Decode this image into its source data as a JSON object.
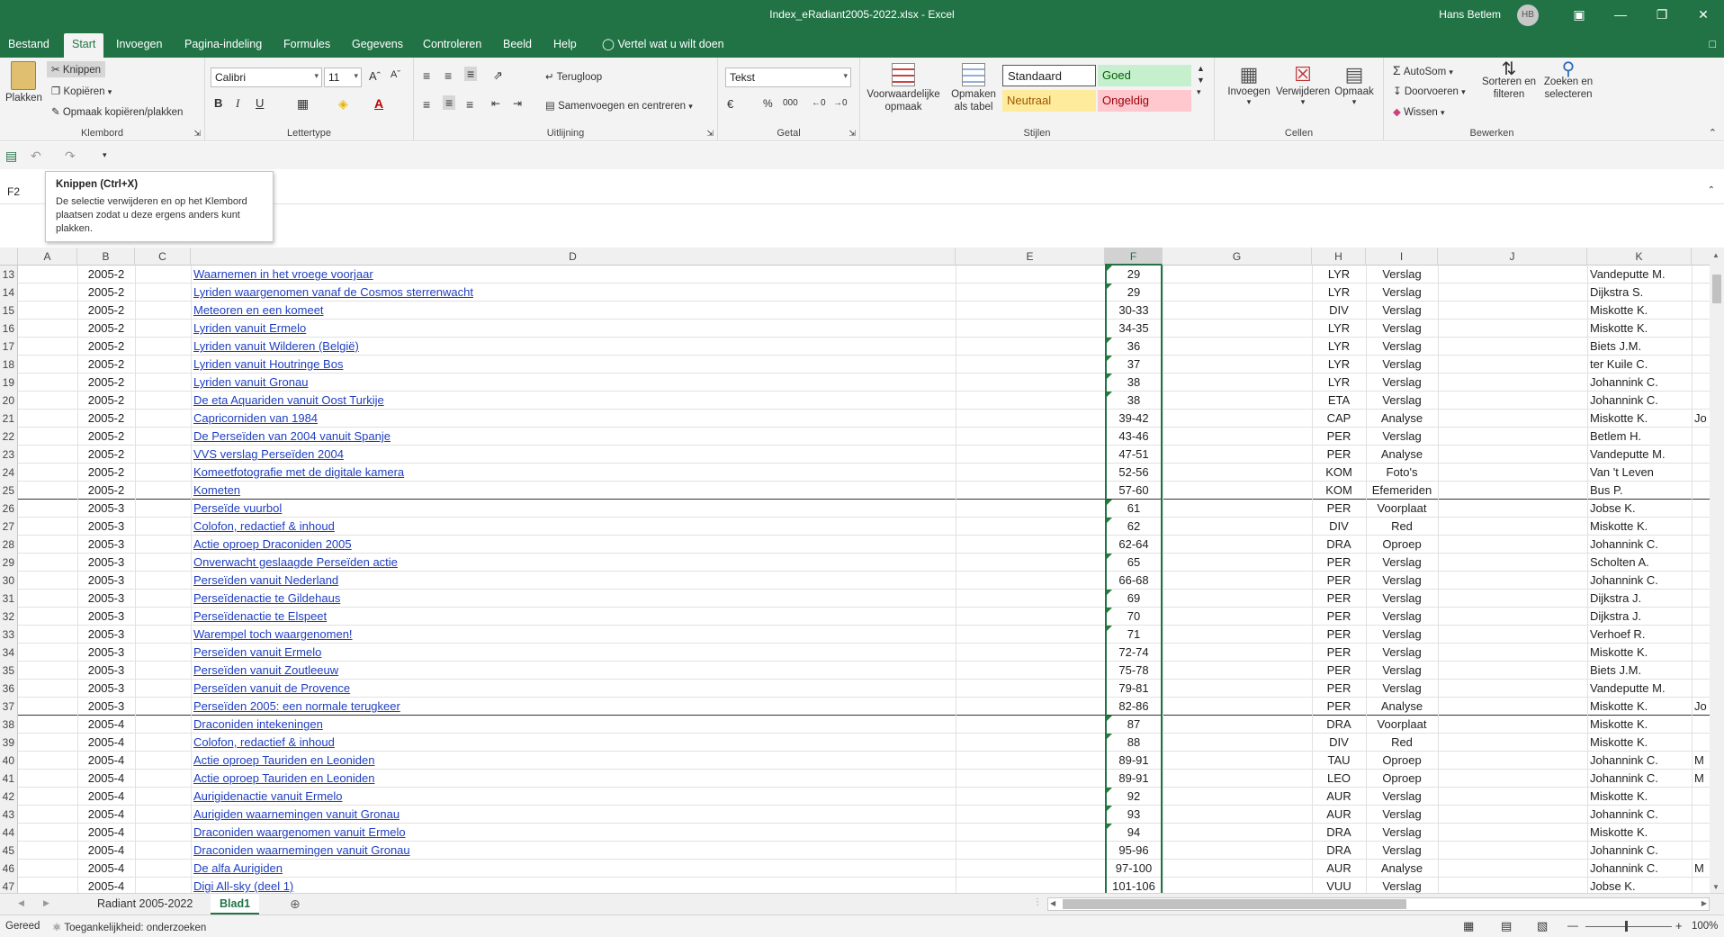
{
  "window": {
    "title": "Index_eRadiant2005-2022.xlsx  -  Excel",
    "user": "Hans Betlem",
    "initials": "HB"
  },
  "tabs": [
    "Bestand",
    "Start",
    "Invoegen",
    "Pagina-indeling",
    "Formules",
    "Gegevens",
    "Controleren",
    "Beeld",
    "Help"
  ],
  "tell_me": "Vertel wat u wilt doen",
  "ribbon": {
    "clipboard": {
      "paste": "Plakken",
      "cut": "Knippen",
      "copy": "Kopiëren",
      "format_painter": "Opmaak kopiëren/plakken",
      "label": "Klembord"
    },
    "font": {
      "name": "Calibri",
      "size": "11",
      "label": "Lettertype"
    },
    "alignment": {
      "wrap": "Terugloop",
      "merge": "Samenvoegen en centreren",
      "label": "Uitlijning"
    },
    "number": {
      "format": "Tekst",
      "label": "Getal"
    },
    "styles": {
      "conditional": "Voorwaardelijke opmaak",
      "as_table": "Opmaken als tabel",
      "standaard": "Standaard",
      "goed": "Goed",
      "neutraal": "Neutraal",
      "ongeldig": "Ongeldig",
      "label": "Stijlen"
    },
    "cells": {
      "insert": "Invoegen",
      "delete": "Verwijderen",
      "format": "Opmaak",
      "label": "Cellen"
    },
    "editing": {
      "autosum": "AutoSom",
      "fill": "Doorvoeren",
      "clear": "Wissen",
      "sort": "Sorteren en filteren",
      "find": "Zoeken en selecteren",
      "label": "Bewerken"
    }
  },
  "namebox": "F2",
  "tooltip": {
    "title": "Knippen (Ctrl+X)",
    "body": "De selectie verwijderen en op het Klembord plaatsen zodat u deze ergens anders kunt plakken."
  },
  "columns": [
    "A",
    "B",
    "C",
    "D",
    "E",
    "F",
    "G",
    "H",
    "I",
    "J",
    "K"
  ],
  "rows": [
    {
      "n": "13",
      "b": "2005-2",
      "d": "Waarnemen in het vroege voorjaar",
      "f": "29",
      "h": "LYR",
      "i": "Verslag",
      "k": "Vandeputte M.",
      "tri": true
    },
    {
      "n": "14",
      "b": "2005-2",
      "d": "Lyriden waargenomen vanaf de Cosmos sterrenwacht",
      "f": "29",
      "h": "LYR",
      "i": "Verslag",
      "k": "Dijkstra S.",
      "tri": true
    },
    {
      "n": "15",
      "b": "2005-2",
      "d": "Meteoren en een komeet",
      "f": "30-33",
      "h": "DIV",
      "i": "Verslag",
      "k": "Miskotte K."
    },
    {
      "n": "16",
      "b": "2005-2",
      "d": "Lyriden vanuit Ermelo",
      "f": "34-35",
      "h": "LYR",
      "i": "Verslag",
      "k": "Miskotte K."
    },
    {
      "n": "17",
      "b": "2005-2",
      "d": "Lyriden vanuit Wilderen (België)",
      "f": "36",
      "h": "LYR",
      "i": "Verslag",
      "k": "Biets J.M.",
      "tri": true
    },
    {
      "n": "18",
      "b": "2005-2",
      "d": "Lyriden vanuit Houtringe Bos",
      "f": "37",
      "h": "LYR",
      "i": "Verslag",
      "k": "ter Kuile C.",
      "tri": true
    },
    {
      "n": "19",
      "b": "2005-2",
      "d": "Lyriden vanuit Gronau",
      "f": "38",
      "h": "LYR",
      "i": "Verslag",
      "k": "Johannink C.",
      "tri": true
    },
    {
      "n": "20",
      "b": "2005-2",
      "d": "De eta Aquariden vanuit Oost Turkije",
      "f": "38",
      "h": "ETA",
      "i": "Verslag",
      "k": "Johannink C.",
      "tri": true
    },
    {
      "n": "21",
      "b": "2005-2",
      "d": "Capricorniden van 1984",
      "f": "39-42",
      "h": "CAP",
      "i": "Analyse",
      "k": "Miskotte K.",
      "l": "Jo"
    },
    {
      "n": "22",
      "b": "2005-2",
      "d": "De Perseïden van 2004 vanuit Spanje",
      "f": "43-46",
      "h": "PER",
      "i": "Verslag",
      "k": "Betlem H."
    },
    {
      "n": "23",
      "b": "2005-2",
      "d": "VVS verslag Perseïden 2004",
      "f": "47-51",
      "h": "PER",
      "i": "Analyse",
      "k": "Vandeputte M."
    },
    {
      "n": "24",
      "b": "2005-2",
      "d": "Komeetfotografie met de digitale kamera",
      "f": "52-56",
      "h": "KOM",
      "i": "Foto's",
      "k": "Van 't Leven"
    },
    {
      "n": "25",
      "b": "2005-2",
      "d": "Kometen",
      "f": "57-60",
      "h": "KOM",
      "i": "Efemeriden",
      "k": "Bus P.",
      "thick": true
    },
    {
      "n": "26",
      "b": "2005-3",
      "d": "Perseïde vuurbol",
      "f": "61",
      "h": "PER",
      "i": "Voorplaat",
      "k": "Jobse K.",
      "tri": true
    },
    {
      "n": "27",
      "b": "2005-3",
      "d": "Colofon, redactief & inhoud",
      "f": "62",
      "h": "DIV",
      "i": "Red",
      "k": "Miskotte K.",
      "tri": true
    },
    {
      "n": "28",
      "b": "2005-3",
      "d": "Actie oproep Draconiden 2005",
      "f": "62-64",
      "h": "DRA",
      "i": "Oproep",
      "k": "Johannink C."
    },
    {
      "n": "29",
      "b": "2005-3",
      "d": "Onverwacht geslaagde Perseïden actie",
      "f": "65",
      "h": "PER",
      "i": "Verslag",
      "k": "Scholten A.",
      "tri": true
    },
    {
      "n": "30",
      "b": "2005-3",
      "d": "Perseïden vanuit Nederland",
      "f": "66-68",
      "h": "PER",
      "i": "Verslag",
      "k": "Johannink C."
    },
    {
      "n": "31",
      "b": "2005-3",
      "d": "Perseïdenactie te Gildehaus",
      "f": "69",
      "h": "PER",
      "i": "Verslag",
      "k": "Dijkstra J.",
      "tri": true
    },
    {
      "n": "32",
      "b": "2005-3",
      "d": "Perseïdenactie te Elspeet",
      "f": "70",
      "h": "PER",
      "i": "Verslag",
      "k": "Dijkstra J.",
      "tri": true
    },
    {
      "n": "33",
      "b": "2005-3",
      "d": "Warempel toch waargenomen!",
      "f": "71",
      "h": "PER",
      "i": "Verslag",
      "k": "Verhoef R.",
      "tri": true
    },
    {
      "n": "34",
      "b": "2005-3",
      "d": "Perseïden vanuit Ermelo",
      "f": "72-74",
      "h": "PER",
      "i": "Verslag",
      "k": "Miskotte K."
    },
    {
      "n": "35",
      "b": "2005-3",
      "d": "Perseïden vanuit Zoutleeuw",
      "f": "75-78",
      "h": "PER",
      "i": "Verslag",
      "k": "Biets J.M."
    },
    {
      "n": "36",
      "b": "2005-3",
      "d": "Perseïden vanuit de Provence",
      "f": "79-81",
      "h": "PER",
      "i": "Verslag",
      "k": "Vandeputte M."
    },
    {
      "n": "37",
      "b": "2005-3",
      "d": "Perseïden 2005: een normale terugkeer",
      "f": "82-86",
      "h": "PER",
      "i": "Analyse",
      "k": "Miskotte K.",
      "l": "Jo",
      "thick": true
    },
    {
      "n": "38",
      "b": "2005-4",
      "d": "Draconiden intekeningen",
      "f": "87",
      "h": "DRA",
      "i": "Voorplaat",
      "k": "Miskotte K.",
      "tri": true
    },
    {
      "n": "39",
      "b": "2005-4",
      "d": "Colofon, redactief & inhoud",
      "f": "88",
      "h": "DIV",
      "i": "Red",
      "k": "Miskotte K.",
      "tri": true
    },
    {
      "n": "40",
      "b": "2005-4",
      "d": "Actie oproep Tauriden en Leoniden",
      "f": "89-91",
      "h": "TAU",
      "i": "Oproep",
      "k": "Johannink C.",
      "l": "M"
    },
    {
      "n": "41",
      "b": "2005-4",
      "d": "Actie oproep Tauriden en Leoniden",
      "f": "89-91",
      "h": "LEO",
      "i": "Oproep",
      "k": "Johannink C.",
      "l": "M"
    },
    {
      "n": "42",
      "b": "2005-4",
      "d": "Aurigidenactie vanuit Ermelo",
      "f": "92",
      "h": "AUR",
      "i": "Verslag",
      "k": "Miskotte K.",
      "tri": true
    },
    {
      "n": "43",
      "b": "2005-4",
      "d": "Aurigiden waarnemingen vanuit Gronau",
      "f": "93",
      "h": "AUR",
      "i": "Verslag",
      "k": "Johannink C.",
      "tri": true
    },
    {
      "n": "44",
      "b": "2005-4",
      "d": "Draconiden waargenomen vanuit Ermelo",
      "f": "94",
      "h": "DRA",
      "i": "Verslag",
      "k": "Miskotte K.",
      "tri": true
    },
    {
      "n": "45",
      "b": "2005-4",
      "d": "Draconiden waarnemingen vanuit Gronau",
      "f": "95-96",
      "h": "DRA",
      "i": "Verslag",
      "k": "Johannink C."
    },
    {
      "n": "46",
      "b": "2005-4",
      "d": "De alfa Aurigiden",
      "f": "97-100",
      "h": "AUR",
      "i": "Analyse",
      "k": "Johannink C.",
      "l": "M"
    },
    {
      "n": "47",
      "b": "2005-4",
      "d": "Digi All-sky (deel 1)",
      "f": "101-106",
      "h": "VUU",
      "i": "Verslag",
      "k": "Jobse K."
    }
  ],
  "sheets": [
    "Radiant 2005-2022",
    "Blad1"
  ],
  "status": {
    "ready": "Gereed",
    "accessibility": "Toegankelijkheid: onderzoeken",
    "zoom": "100%"
  },
  "colors": {
    "excel_green": "#217346",
    "link": "#1f3fc0",
    "good_bg": "#c6efce",
    "good_fg": "#006100",
    "neutral_bg": "#ffeb9c",
    "neutral_fg": "#9c5700",
    "bad_bg": "#ffc7ce",
    "bad_fg": "#9c0006"
  }
}
